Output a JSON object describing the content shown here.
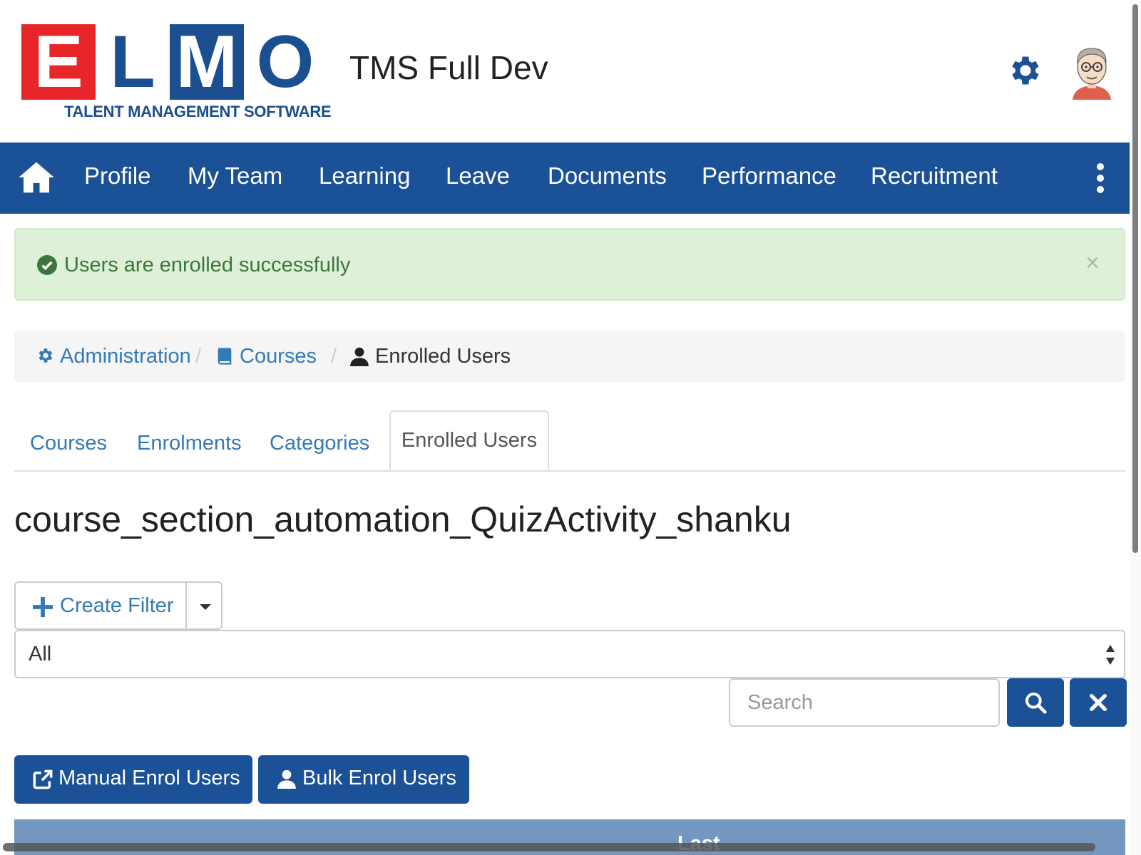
{
  "header": {
    "logo_letters": [
      "E",
      "L",
      "M",
      "O"
    ],
    "logo_subtitle": "TALENT MANAGEMENT SOFTWARE",
    "app_title": "TMS Full Dev",
    "colors": {
      "logo_red": "#e8262a",
      "logo_blue": "#1c4f8f"
    },
    "icons": {
      "settings": "gear-icon",
      "avatar": "user-avatar"
    }
  },
  "nav": {
    "items": [
      "Profile",
      "My Team",
      "Learning",
      "Leave",
      "Documents",
      "Performance",
      "Recruitment"
    ],
    "icons": {
      "home": "home-icon",
      "more": "vertical-ellipsis-icon"
    },
    "color": "#1a5197"
  },
  "alert": {
    "message": "Users are enrolled successfully",
    "close": "×",
    "icon": "check-circle-icon"
  },
  "breadcrumb": {
    "items": [
      {
        "label": "Administration",
        "icon": "gear-icon"
      },
      {
        "label": "Courses",
        "icon": "book-icon"
      },
      {
        "label": "Enrolled Users",
        "icon": "user-icon"
      }
    ],
    "separator": "/"
  },
  "tabs": {
    "items": [
      "Courses",
      "Enrolments",
      "Categories"
    ],
    "active": "Enrolled Users"
  },
  "course_title": "course_section_automation_QuizActivity_shanku",
  "filter": {
    "create_label": "Create Filter",
    "select_value": "All"
  },
  "search": {
    "placeholder": "Search"
  },
  "actions": {
    "manual_enrol": "Manual Enrol Users",
    "bulk_enrol": "Bulk Enrol Users"
  },
  "table": {
    "header_visible": "Last"
  }
}
